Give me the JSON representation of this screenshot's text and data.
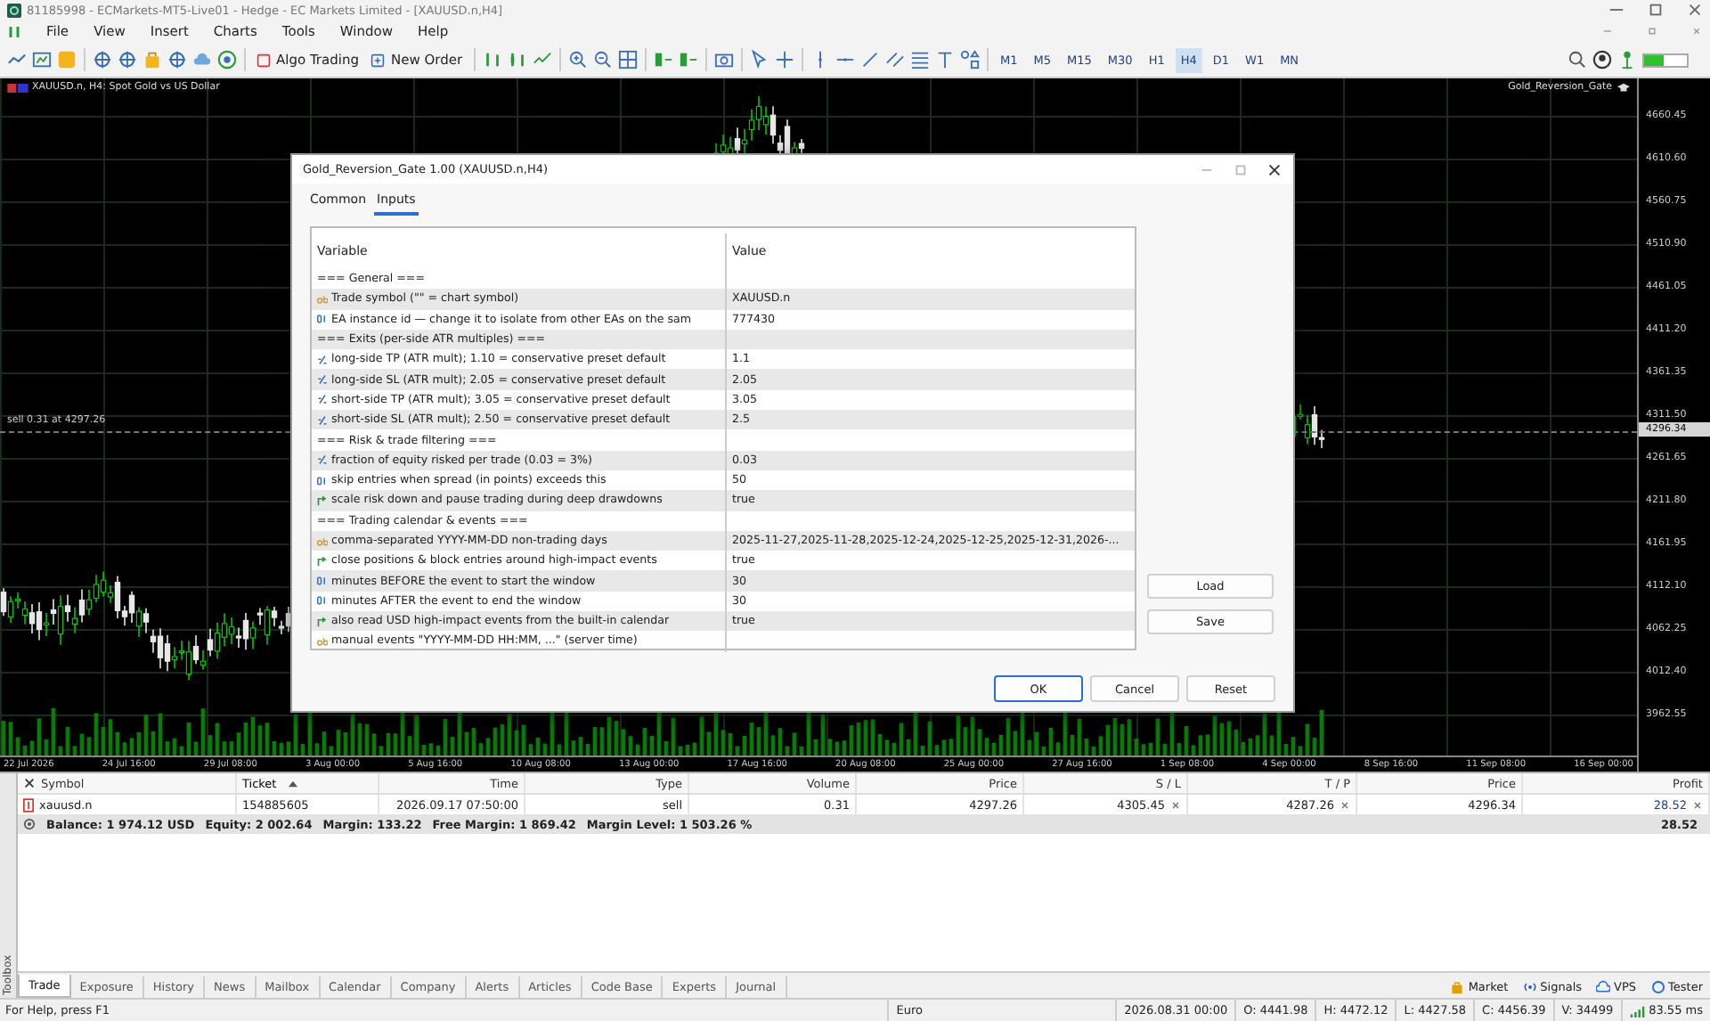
{
  "window": {
    "title": "81185998 - ECMarkets-MT5-Live01 - Hedge - EC Markets Limited - [XAUUSD.n,H4]"
  },
  "menu": [
    "File",
    "View",
    "Insert",
    "Charts",
    "Tools",
    "Window",
    "Help"
  ],
  "toolbar": {
    "algo_trading": "Algo Trading",
    "new_order": "New Order",
    "timeframes": [
      {
        "label": "M1",
        "selected": false
      },
      {
        "label": "M5",
        "selected": false
      },
      {
        "label": "M15",
        "selected": false
      },
      {
        "label": "M30",
        "selected": false
      },
      {
        "label": "H1",
        "selected": false
      },
      {
        "label": "H4",
        "selected": true
      },
      {
        "label": "D1",
        "selected": false
      },
      {
        "label": "W1",
        "selected": false
      },
      {
        "label": "MN",
        "selected": false
      }
    ]
  },
  "chart": {
    "symbol_label": "XAUUSD.n, H4: Spot Gold vs US Dollar",
    "expert_label": "Gold_Reversion_Gate",
    "trade_label": "sell 0.31 at 4297.26",
    "current_price": "4296.34",
    "price_ticks": [
      "4660.45",
      "4610.60",
      "4560.75",
      "4510.90",
      "4461.05",
      "4411.20",
      "4361.35",
      "4311.50",
      "4261.65",
      "4211.80",
      "4161.95",
      "4112.10",
      "4062.25",
      "4012.40",
      "3962.55"
    ],
    "time_ticks": [
      "22 Jul 2026",
      "24 Jul 16:00",
      "29 Jul 08:00",
      "3 Aug 00:00",
      "5 Aug 16:00",
      "10 Aug 08:00",
      "13 Aug 00:00",
      "17 Aug 16:00",
      "20 Aug 08:00",
      "25 Aug 00:00",
      "27 Aug 16:00",
      "1 Sep 08:00",
      "4 Sep 00:00",
      "8 Sep 16:00",
      "11 Sep 08:00",
      "16 Sep 00:00"
    ]
  },
  "dialog": {
    "title": "Gold_Reversion_Gate 1.00 (XAUUSD.n,H4)",
    "tabs": [
      {
        "label": "Common",
        "selected": false
      },
      {
        "label": "Inputs",
        "selected": true
      }
    ],
    "columns": [
      "Variable",
      "Value"
    ],
    "params": [
      {
        "kind": "header",
        "name": "=== General ==="
      },
      {
        "kind": "string",
        "name": "Trade symbol (\"\" = chart symbol)",
        "value": "XAUUSD.n"
      },
      {
        "kind": "int",
        "name": "EA instance id — change it to isolate from other EAs on the sam",
        "value": "777430"
      },
      {
        "kind": "header",
        "name": "=== Exits (per-side ATR multiples) ==="
      },
      {
        "kind": "double",
        "name": "long-side TP (ATR mult); 1.10 = conservative preset default",
        "value": "1.1"
      },
      {
        "kind": "double",
        "name": "long-side SL (ATR mult); 2.05 = conservative preset default",
        "value": "2.05"
      },
      {
        "kind": "double",
        "name": "short-side TP (ATR mult); 3.05 = conservative preset default",
        "value": "3.05"
      },
      {
        "kind": "double",
        "name": "short-side SL (ATR mult); 2.50 = conservative preset default",
        "value": "2.5"
      },
      {
        "kind": "header",
        "name": "=== Risk & trade filtering ==="
      },
      {
        "kind": "double",
        "name": "fraction of equity risked per trade (0.03 = 3%)",
        "value": "0.03"
      },
      {
        "kind": "int",
        "name": "skip entries when spread (in points) exceeds this",
        "value": "50"
      },
      {
        "kind": "bool",
        "name": "scale risk down and pause trading during deep drawdowns",
        "value": "true"
      },
      {
        "kind": "header",
        "name": "=== Trading calendar & events ==="
      },
      {
        "kind": "string",
        "name": "comma-separated YYYY-MM-DD non-trading days",
        "value": "2025-11-27,2025-11-28,2025-12-24,2025-12-25,2025-12-31,2026-..."
      },
      {
        "kind": "bool",
        "name": "close positions & block entries around high-impact events",
        "value": "true"
      },
      {
        "kind": "int",
        "name": "minutes BEFORE the event to start the window",
        "value": "30"
      },
      {
        "kind": "int",
        "name": "minutes AFTER the event to end the window",
        "value": "30"
      },
      {
        "kind": "bool",
        "name": "also read USD high-impact events from the built-in calendar",
        "value": "true"
      },
      {
        "kind": "string",
        "name": "manual events \"YYYY-MM-DD HH:MM, ...\" (server time)"
      }
    ],
    "side_buttons": [
      "Load",
      "Save"
    ],
    "footer_buttons": [
      {
        "label": "OK",
        "default": true
      },
      {
        "label": "Cancel",
        "default": false
      },
      {
        "label": "Reset",
        "default": false
      }
    ]
  },
  "terminal": {
    "columns": [
      {
        "label": "Symbol",
        "sorted": false
      },
      {
        "label": "Ticket",
        "sorted": true
      },
      {
        "label": "Time",
        "sorted": false
      },
      {
        "label": "Type",
        "sorted": false
      },
      {
        "label": "Volume",
        "sorted": false
      },
      {
        "label": "Price",
        "sorted": false
      },
      {
        "label": "S / L",
        "sorted": false
      },
      {
        "label": "T / P",
        "sorted": false
      },
      {
        "label": "Price",
        "sorted": false
      },
      {
        "label": "Profit",
        "sorted": false
      }
    ],
    "rows": [
      {
        "symbol": "xauusd.n",
        "ticket": "154885605",
        "time": "2026.09.17 07:50:00",
        "type": "sell",
        "volume": "0.31",
        "price": "4297.26",
        "sl": "4305.45",
        "tp": "4287.26",
        "current": "4296.34",
        "profit": "28.52"
      }
    ],
    "summary": {
      "items": [
        "Balance: 1 974.12 USD",
        "Equity: 2 002.64",
        "Margin: 133.22",
        "Free Margin: 1 869.42",
        "Margin Level: 1 503.26 %"
      ],
      "profit": "28.52"
    },
    "toolbox_label": "Toolbox",
    "tabs": [
      {
        "label": "Trade",
        "selected": true
      },
      {
        "label": "Exposure",
        "selected": false
      },
      {
        "label": "History",
        "selected": false
      },
      {
        "label": "News",
        "selected": false
      },
      {
        "label": "Mailbox",
        "selected": false
      },
      {
        "label": "Calendar",
        "selected": false
      },
      {
        "label": "Company",
        "selected": false
      },
      {
        "label": "Alerts",
        "selected": false
      },
      {
        "label": "Articles",
        "selected": false
      },
      {
        "label": "Code Base",
        "selected": false
      },
      {
        "label": "Experts",
        "selected": false
      },
      {
        "label": "Journal",
        "selected": false
      }
    ],
    "services": [
      {
        "kind": "market",
        "label": "Market"
      },
      {
        "kind": "signals",
        "label": "Signals"
      },
      {
        "kind": "vps",
        "label": "VPS"
      },
      {
        "kind": "tester",
        "label": "Tester"
      }
    ]
  },
  "status_bar": {
    "help": "For Help, press F1",
    "profile": "Euro",
    "time": "2026.08.31 00:00",
    "open": "O: 4441.98",
    "high": "H: 4472.12",
    "low": "L: 4427.58",
    "close": "C: 4456.39",
    "volume": "V: 34499",
    "ping": "83.55 ms"
  }
}
